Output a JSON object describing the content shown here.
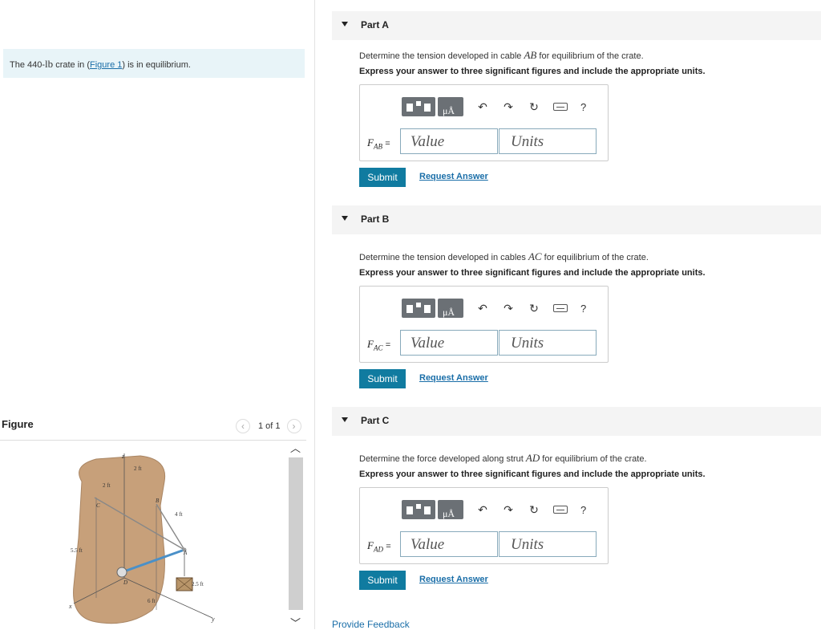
{
  "intro": {
    "prefix": "The 440-",
    "unit": "lb",
    "middle": " crate in (",
    "link": "Figure 1",
    "suffix": ") is in equilibrium."
  },
  "figure_panel": {
    "title": "Figure",
    "page": "1 of 1"
  },
  "figure_labels": {
    "z": "z",
    "x": "x",
    "y": "y",
    "c": "C",
    "b": "B",
    "a": "A",
    "d": "D",
    "d1": "2 ft",
    "d2": "2 ft",
    "d3": "4 ft",
    "d4": "5.5 ft",
    "d5": "2.5 ft",
    "d6": "6 ft"
  },
  "toolbar": {
    "unit_glyph": "μÅ",
    "undo": "↶",
    "redo": "↷",
    "reset": "↻",
    "help": "?"
  },
  "parts": [
    {
      "title": "Part A",
      "q_pre": "Determine the tension developed in cable ",
      "q_var": "AB",
      "q_post": " for equilibrium of the crate.",
      "instruction": "Express your answer to three significant figures and include the appropriate units.",
      "var_main": "F",
      "var_sub": "AB",
      "eq": "=",
      "value_placeholder": "Value",
      "units_placeholder": "Units",
      "submit": "Submit",
      "request": "Request Answer"
    },
    {
      "title": "Part B",
      "q_pre": "Determine the tension developed in cables ",
      "q_var": "AC",
      "q_post": " for equilibrium of the crate.",
      "instruction": "Express your answer to three significant figures and include the appropriate units.",
      "var_main": "F",
      "var_sub": "AC",
      "eq": "=",
      "value_placeholder": "Value",
      "units_placeholder": "Units",
      "submit": "Submit",
      "request": "Request Answer"
    },
    {
      "title": "Part C",
      "q_pre": "Determine the force developed along strut ",
      "q_var": "AD",
      "q_post": " for equilibrium of the crate.",
      "instruction": "Express your answer to three significant figures and include the appropriate units.",
      "var_main": "F",
      "var_sub": "AD",
      "eq": "=",
      "value_placeholder": "Value",
      "units_placeholder": "Units",
      "submit": "Submit",
      "request": "Request Answer"
    }
  ],
  "feedback": "Provide Feedback"
}
